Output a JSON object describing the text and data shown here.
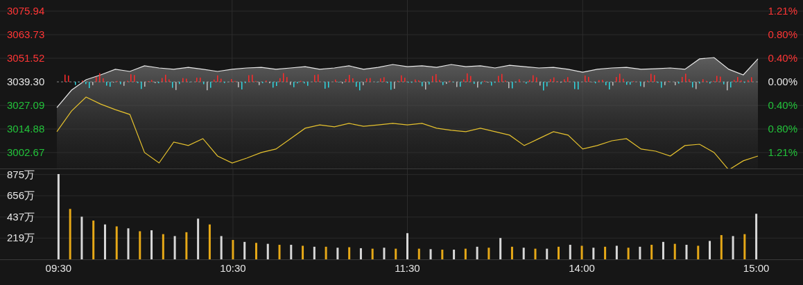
{
  "price_panel": {
    "chart_data": {
      "type": "line",
      "grid": true,
      "ylim": [
        2993.7,
        3081.7
      ],
      "yticks": [
        {
          "value": 3075.94,
          "label": "3075.94"
        },
        {
          "value": 3063.73,
          "label": "3063.73"
        },
        {
          "value": 3051.52,
          "label": "3051.52"
        },
        {
          "value": 3039.3,
          "label": "3039.30"
        },
        {
          "value": 3027.09,
          "label": "3027.09"
        },
        {
          "value": 3014.88,
          "label": "3014.88"
        },
        {
          "value": 3002.67,
          "label": "3002.67"
        }
      ],
      "series": [
        {
          "color": "#e8e8e8",
          "values": [
            3026,
            3035,
            3040.4,
            3042.9,
            3045.8,
            3044.7,
            3047.6,
            3046.5,
            3045.8,
            3046.8,
            3045.8,
            3044.7,
            3045.8,
            3046.5,
            3046.8,
            3045.8,
            3046.5,
            3047.2,
            3045.8,
            3046.5,
            3047.6,
            3045.8,
            3046.8,
            3048.3,
            3047.2,
            3047.6,
            3046.8,
            3048.3,
            3047.2,
            3047.6,
            3046.5,
            3047.9,
            3047.2,
            3046.5,
            3046.8,
            3045.8,
            3044.3,
            3045.8,
            3046.5,
            3046.8,
            3045.8,
            3046.1,
            3046.5,
            3045.8,
            3051.2,
            3051.9,
            3045.8,
            3042.9,
            3051.2
          ]
        },
        {
          "color": "#e6c22e",
          "values": [
            3013.5,
            3024.2,
            3031.4,
            3027.8,
            3024.9,
            3022.4,
            3002.7,
            2997.3,
            3008.1,
            3006.3,
            3009.9,
            3000.9,
            2997.3,
            2999.8,
            3002.7,
            3004.5,
            3009.9,
            3015.3,
            3017,
            3016,
            3017.8,
            3016.3,
            3017,
            3017.8,
            3017,
            3017.8,
            3015.3,
            3014.2,
            3013.5,
            3015.3,
            3013.5,
            3011.7,
            3006.3,
            3009.9,
            3013.5,
            3011.7,
            3004.5,
            3006.3,
            3008.8,
            3009.9,
            3004.5,
            3003.4,
            3000.9,
            3006.3,
            3007,
            3002.7,
            2993.7,
            2998.4,
            3000.9
          ]
        }
      ]
    },
    "right_ticks": [
      "1.21%",
      "0.80%",
      "0.40%",
      "0.00%",
      "0.40%",
      "0.80%",
      "1.21%"
    ]
  },
  "volume_panel": {
    "chart_data": {
      "type": "bar",
      "stacked": true,
      "grid": true,
      "ylim": [
        0,
        930
      ],
      "categories": [
        "09:30",
        null,
        null,
        null,
        null,
        null,
        null,
        null,
        null,
        null,
        null,
        null,
        null,
        null,
        null,
        "10:30",
        null,
        null,
        null,
        null,
        null,
        null,
        null,
        null,
        null,
        null,
        null,
        null,
        null,
        null,
        "11:30",
        null,
        null,
        null,
        null,
        null,
        null,
        null,
        null,
        null,
        null,
        null,
        null,
        null,
        null,
        "14:00",
        null,
        null,
        null,
        null,
        null,
        null,
        null,
        null,
        null,
        null,
        null,
        null,
        null,
        null,
        "15:00"
      ],
      "yticks": [
        {
          "value": 219,
          "label": "219万"
        },
        {
          "value": 437,
          "label": "437万"
        },
        {
          "value": 656,
          "label": "656万"
        },
        {
          "value": 875,
          "label": "875万"
        }
      ],
      "series": [
        {
          "color": "#e6a817",
          "values": [
            null,
            520,
            null,
            400,
            null,
            340,
            null,
            290,
            null,
            260,
            null,
            280,
            null,
            360,
            null,
            200,
            null,
            170,
            null,
            150,
            null,
            140,
            null,
            130,
            null,
            125,
            null,
            110,
            null,
            110,
            null,
            110,
            null,
            100,
            null,
            110,
            null,
            120,
            null,
            130,
            null,
            110,
            null,
            130,
            null,
            140,
            null,
            130,
            null,
            120,
            null,
            150,
            null,
            160,
            null,
            140,
            null,
            250,
            null,
            260,
            null
          ]
        },
        {
          "color": "#d8d8d8",
          "values": [
            880,
            null,
            440,
            null,
            360,
            null,
            320,
            null,
            300,
            null,
            240,
            null,
            420,
            null,
            240,
            null,
            180,
            null,
            160,
            null,
            150,
            null,
            130,
            null,
            120,
            null,
            115,
            null,
            120,
            null,
            270,
            null,
            105,
            null,
            100,
            null,
            130,
            null,
            220,
            null,
            120,
            null,
            110,
            null,
            150,
            null,
            120,
            null,
            140,
            null,
            130,
            null,
            180,
            null,
            150,
            null,
            190,
            null,
            240,
            null,
            470
          ]
        }
      ]
    }
  }
}
